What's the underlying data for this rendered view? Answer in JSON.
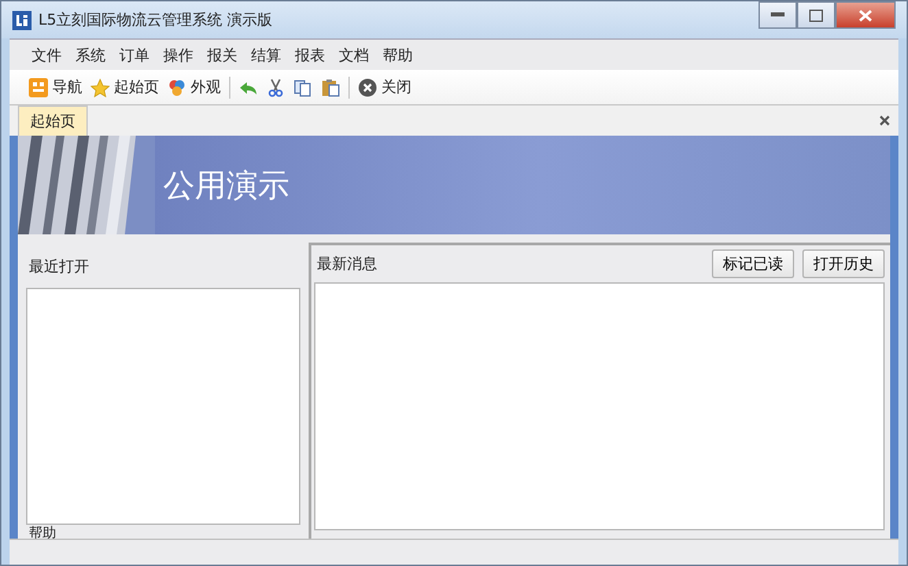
{
  "window": {
    "title": "L5立刻国际物流云管理系统 演示版"
  },
  "menu": [
    "文件",
    "系统",
    "订单",
    "操作",
    "报关",
    "结算",
    "报表",
    "文档",
    "帮助"
  ],
  "toolbar": [
    {
      "kind": "button",
      "label": "导航"
    },
    {
      "kind": "button",
      "label": "起始页"
    },
    {
      "kind": "button",
      "label": "外观"
    },
    {
      "kind": "separator"
    },
    {
      "kind": "icon"
    },
    {
      "kind": "icon"
    },
    {
      "kind": "icon"
    },
    {
      "kind": "icon"
    },
    {
      "kind": "separator"
    },
    {
      "kind": "button",
      "label": "关闭"
    }
  ],
  "tabs": [
    {
      "label": "起始页",
      "selected": true
    }
  ],
  "banner": {
    "title": "公用演示"
  },
  "recent": {
    "title": "最近打开"
  },
  "news": {
    "title": "最新消息",
    "buttons": [
      "标记已读",
      "打开历史"
    ]
  },
  "help": {
    "title": "帮助"
  }
}
